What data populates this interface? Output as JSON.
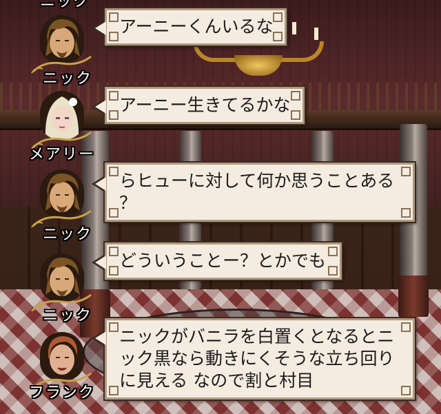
{
  "top_partial_name": "ニック",
  "messages": [
    {
      "speaker": "ニック",
      "character": "nick",
      "text": "アーニーくんいるな"
    },
    {
      "speaker": "メアリー",
      "character": "mary",
      "text": "アーニー生きてるかな"
    },
    {
      "speaker": "ニック",
      "character": "nick",
      "text": "らヒューに対して何か思うことある\n？"
    },
    {
      "speaker": "ニック",
      "character": "nick",
      "text": "どういうことー？とかでも"
    },
    {
      "speaker": "フランク",
      "character": "frank",
      "text": "ニックがバニラを白置くとなるとニ\nック黒なら動きにくそうな立ち回り\nに見える なので割と村目"
    }
  ],
  "colors": {
    "bubble_bg": "#f4ece0",
    "bubble_border": "#b09a80",
    "name_text": "#ffffff",
    "frame_gold": "#c9a24a"
  }
}
